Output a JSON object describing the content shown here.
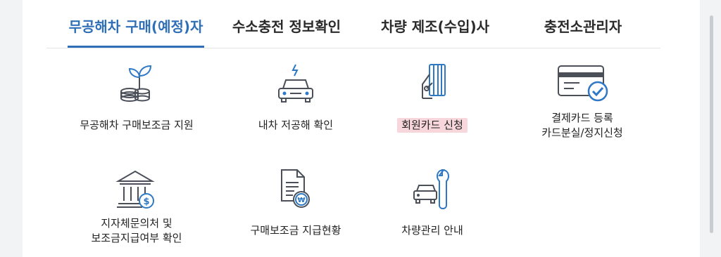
{
  "tabs": [
    {
      "label": "무공해차 구매(예정)자",
      "active": true
    },
    {
      "label": "수소충전 정보확인",
      "active": false
    },
    {
      "label": "차량 제조(수입)사",
      "active": false
    },
    {
      "label": "충전소관리자",
      "active": false
    }
  ],
  "items": [
    {
      "label": "무공해차 구매보조금 지원",
      "icon": "plant-coins-icon"
    },
    {
      "label": "내차 저공해 확인",
      "icon": "electric-car-icon"
    },
    {
      "label": "회원카드 신청",
      "icon": "hand-card-icon",
      "highlighted": true
    },
    {
      "label": "결제카드 등록\n카드분실/정지신청",
      "icon": "card-check-icon"
    },
    {
      "label": "지자체문의처 및\n보조금지급여부 확인",
      "icon": "bank-dollar-icon"
    },
    {
      "label": "구매보조금 지급현황",
      "icon": "document-won-icon"
    },
    {
      "label": "차량관리 안내",
      "icon": "car-wrench-icon"
    }
  ],
  "colors": {
    "accent": "#2f6fb7",
    "icon_stroke": "#4a4f58",
    "icon_blue": "#2f78c4",
    "highlight": "#f7d7dc"
  }
}
